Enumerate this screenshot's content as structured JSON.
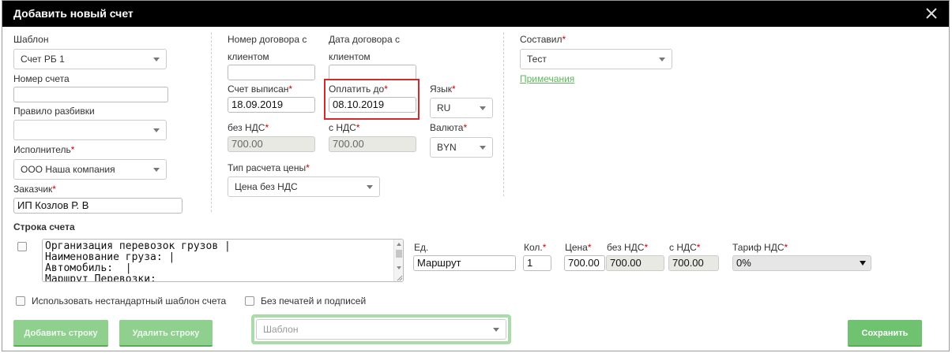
{
  "dialog": {
    "title": "Добавить новый счет",
    "close_icon": "close-icon"
  },
  "left": {
    "template_label": "Шаблон",
    "template_value": "Счет РБ 1",
    "account_number_label": "Номер счета",
    "account_number_value": "",
    "split_rule_label": "Правило разбивки",
    "split_rule_value": "",
    "executor_label": "Исполнитель",
    "executor_value": "ООО Наша компания",
    "customer_label": "Заказчик",
    "customer_value": "ИП Козлов Р. В"
  },
  "middle": {
    "contract_number_label_1": "Номер договора с",
    "contract_number_label_2": "клиентом",
    "contract_number_value": "",
    "contract_date_label_1": "Дата договора с",
    "contract_date_label_2": "клиентом",
    "contract_date_value": "",
    "issued_label": "Счет выписан",
    "issued_value": "18.09.2019",
    "pay_until_label": "Оплатить до",
    "pay_until_value": "08.10.2019",
    "language_label": "Язык",
    "language_value": "RU",
    "no_vat_label": "без НДС",
    "no_vat_value": "700.00",
    "with_vat_label": "с НДС",
    "with_vat_value": "700.00",
    "currency_label": "Валюта",
    "currency_value": "BYN",
    "price_type_label": "Тип расчета цены",
    "price_type_value": "Цена без НДС"
  },
  "right": {
    "composer_label": "Составил",
    "composer_value": "Тест",
    "notes_link": "Примечания"
  },
  "line": {
    "section_title": "Строка счета",
    "description_lines": [
      "Организация перевозок грузов |",
      "Наименование груза: |",
      "Автомобиль:  |",
      "Маршрут Перевозки:"
    ],
    "unit_label": "Ед.",
    "unit_value": "Маршрут",
    "qty_label": "Кол.",
    "qty_value": "1",
    "price_label": "Цена",
    "price_value": "700.00",
    "no_vat_label": "без НДС",
    "no_vat_value": "700.00",
    "with_vat_label": "с НДС",
    "with_vat_value": "700.00",
    "tariff_label": "Тариф НДС",
    "tariff_value": "0%"
  },
  "options": {
    "nonstandard_template": "Использовать нестандартный шаблон счета",
    "no_stamps": "Без печатей и подписей"
  },
  "footer": {
    "add_row": "Добавить строку",
    "delete_row": "Удалить строку",
    "template_placeholder": "Шаблон",
    "save": "Сохранить"
  },
  "colors": {
    "accent_green": "#6fc26f",
    "required_red": "#cc0000",
    "highlight_red": "#d32b2b"
  },
  "required_mark": "*"
}
